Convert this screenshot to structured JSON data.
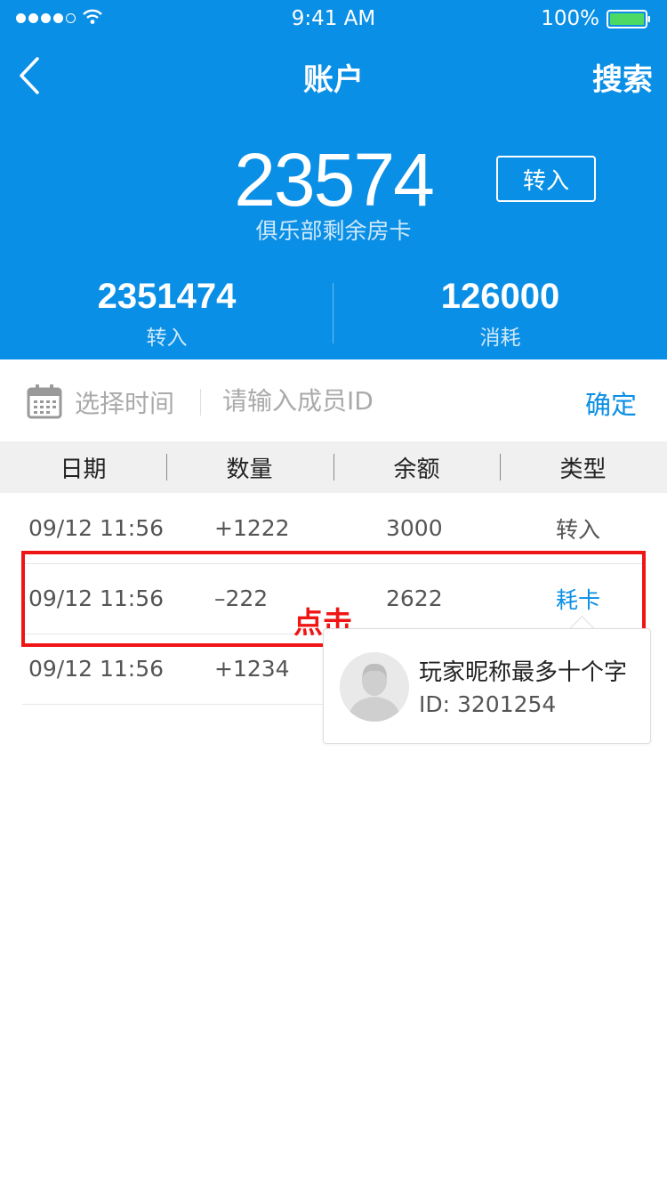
{
  "status_bar": {
    "time": "9:41 AM",
    "battery": "100%"
  },
  "nav": {
    "title": "账户",
    "search_label": "搜索"
  },
  "summary": {
    "balance": "23574",
    "balance_label": "俱乐部剩余房卡",
    "transfer_button": "转入",
    "transfer_in_value": "2351474",
    "transfer_in_label": "转入",
    "consume_value": "126000",
    "consume_label": "消耗"
  },
  "filter": {
    "time_placeholder": "选择时间",
    "member_placeholder": "请输入成员ID",
    "confirm_label": "确定"
  },
  "table": {
    "headers": [
      "日期",
      "数量",
      "余额",
      "类型"
    ],
    "rows": [
      {
        "date": "09/12 11:56",
        "quantity": "+1222",
        "balance": "3000",
        "type": "转入"
      },
      {
        "date": "09/12 11:56",
        "quantity": "–222",
        "balance": "2622",
        "type": "耗卡"
      },
      {
        "date": "09/12 11:56",
        "quantity": "+1234",
        "balance": "",
        "type": ""
      }
    ]
  },
  "annotation": {
    "click_label": "点击",
    "highlight_color": "#f01515"
  },
  "popover": {
    "nickname": "玩家昵称最多十个字",
    "id_text": "ID: 3201254"
  },
  "colors": {
    "accent": "#0A8FE6",
    "highlight": "#f01515"
  },
  "icons": {
    "back": "chevron-left-icon",
    "calendar": "calendar-icon",
    "wifi": "wifi-icon",
    "battery": "battery-icon",
    "avatar": "avatar-icon"
  }
}
